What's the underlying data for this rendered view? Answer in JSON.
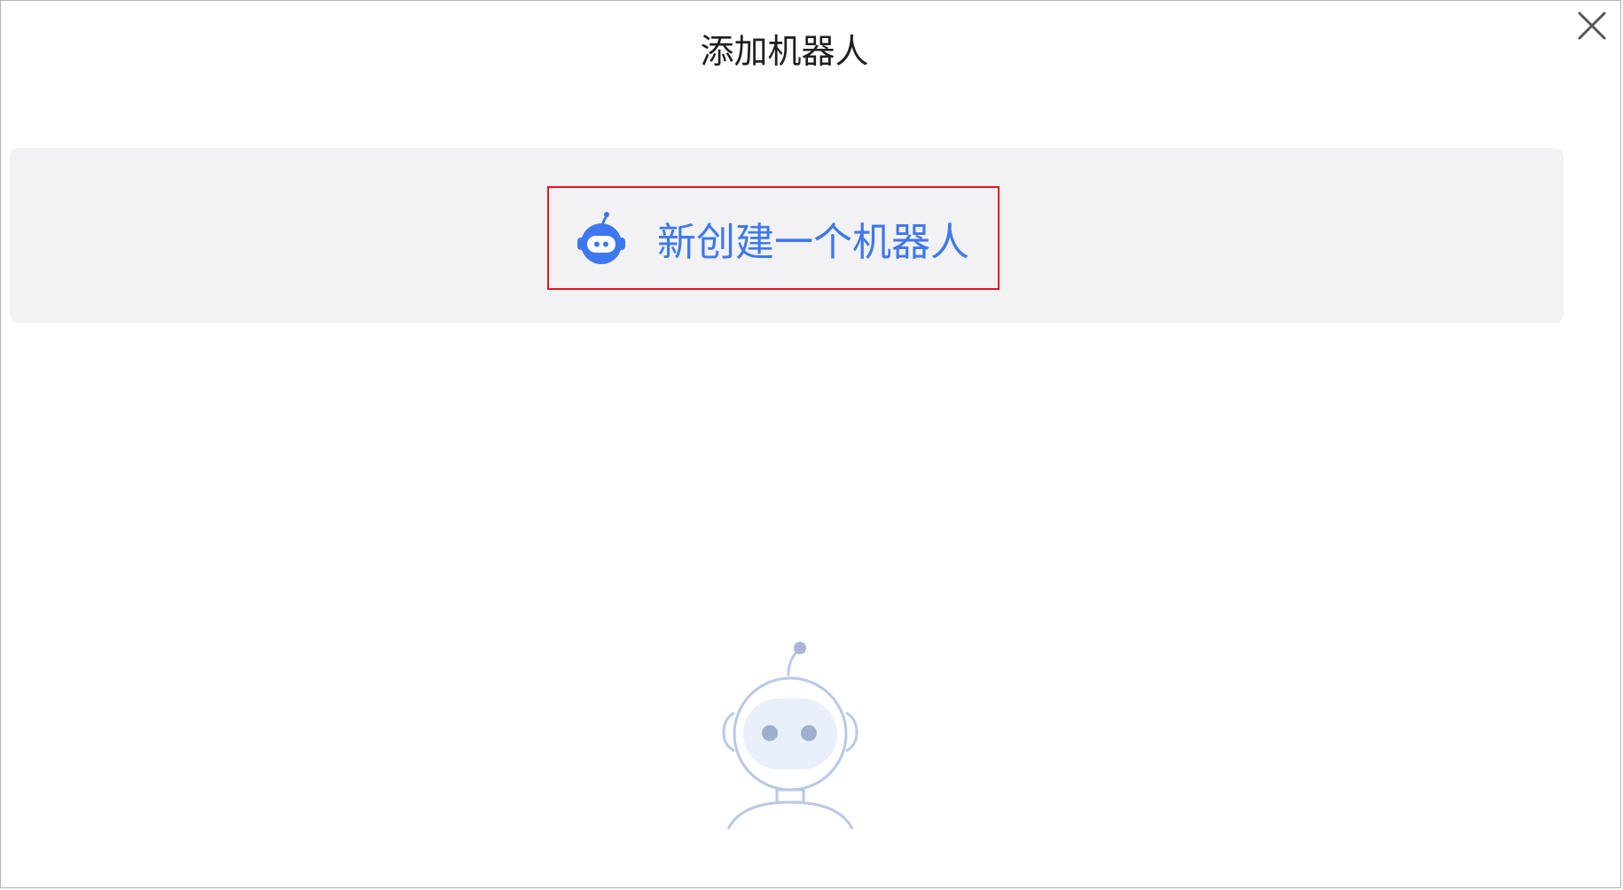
{
  "dialog": {
    "title": "添加机器人",
    "close_icon": "close-icon"
  },
  "create": {
    "label": "新创建一个机器人",
    "icon": "robot-icon",
    "accent_color": "#3d78ee",
    "highlight_color": "#e8141c"
  },
  "empty_state": {
    "icon": "robot-illustration"
  }
}
